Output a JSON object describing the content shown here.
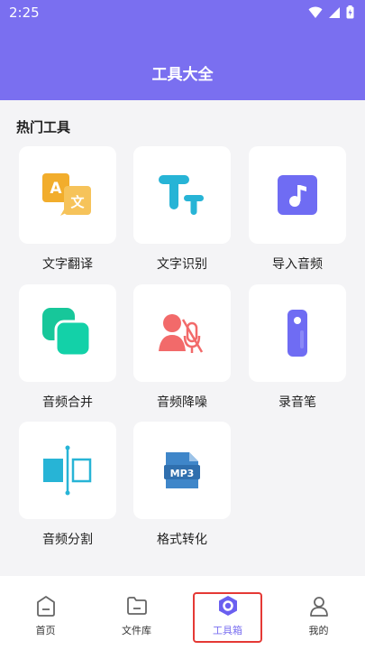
{
  "status_bar": {
    "time": "2:25"
  },
  "header": {
    "title": "工具大全"
  },
  "section": {
    "title": "热门工具"
  },
  "tools": [
    {
      "label": "文字翻译",
      "icon": "translate-icon"
    },
    {
      "label": "文字识别",
      "icon": "text-recognition-icon"
    },
    {
      "label": "导入音频",
      "icon": "import-audio-icon"
    },
    {
      "label": "音频合并",
      "icon": "audio-merge-icon"
    },
    {
      "label": "音频降噪",
      "icon": "audio-denoise-icon"
    },
    {
      "label": "录音笔",
      "icon": "recorder-pen-icon"
    },
    {
      "label": "音频分割",
      "icon": "audio-split-icon"
    },
    {
      "label": "格式转化",
      "icon": "format-convert-icon"
    }
  ],
  "nav": [
    {
      "label": "首页",
      "icon": "home-icon",
      "active": false
    },
    {
      "label": "文件库",
      "icon": "folder-icon",
      "active": false
    },
    {
      "label": "工具箱",
      "icon": "toolbox-icon",
      "active": true
    },
    {
      "label": "我的",
      "icon": "profile-icon",
      "active": false
    }
  ],
  "colors": {
    "brand": "#7a6ff0",
    "highlight": "#e53935"
  }
}
